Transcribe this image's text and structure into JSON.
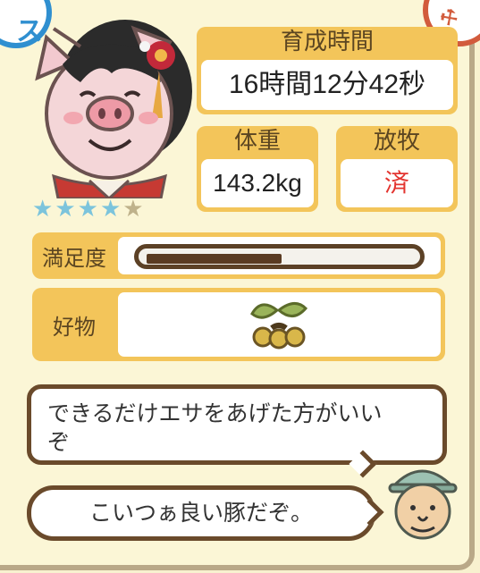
{
  "corners": {
    "left_glyph": "ス",
    "right_glyph": "⚒"
  },
  "stats": {
    "growth_time": {
      "label": "育成時間",
      "value": "16時間12分42秒"
    },
    "weight": {
      "label": "体重",
      "value": "143.2kg"
    },
    "grazing": {
      "label": "放牧",
      "value": "済"
    }
  },
  "rating": {
    "stars_filled": 4,
    "stars_total": 5,
    "star_glyph": "★"
  },
  "satisfaction": {
    "label": "満足度",
    "level": 0.5
  },
  "favorite": {
    "label": "好物",
    "item_icon": "acorn-leaf-icon"
  },
  "dialogue": {
    "line1": "できるだけエサをあげた方がいい",
    "line1b": "ぞ",
    "line2": "こいつぁ良い豚だぞ。"
  },
  "colors": {
    "accent": "#f3c55a",
    "grazing_value": "#e3342f",
    "star_on": "#7cc4dc",
    "star_off": "#bfb28b"
  }
}
